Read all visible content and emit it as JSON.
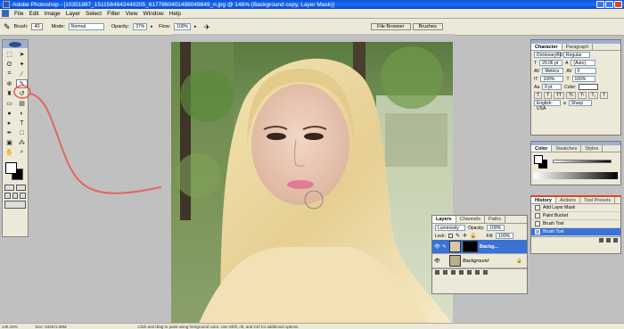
{
  "window": {
    "title": "Adobe Photoshop - [10351887_1511564642440205_6177860401498049649_n.jpg @ 146% (Background copy, Layer Mask)]"
  },
  "menu": [
    "File",
    "Edit",
    "Image",
    "Layer",
    "Select",
    "Filter",
    "View",
    "Window",
    "Help"
  ],
  "options_bar": {
    "brush_label": "Brush:",
    "brush_size": "40",
    "mode_label": "Mode:",
    "mode_value": "Normal",
    "opacity_label": "Opacity:",
    "opacity_value": "37%",
    "flow_label": "Flow:",
    "flow_value": "100%"
  },
  "palette_well": {
    "tabs": [
      "File Browser",
      "Brushes"
    ]
  },
  "character_panel": {
    "tabs": [
      "Character",
      "Paragraph"
    ],
    "font_family": "DictionaryBD",
    "font_style": "Regular",
    "font_size": "29.06 pt",
    "leading": "(Auto)",
    "kerning": "Metrics",
    "tracking": "0",
    "vertical_scale": "100%",
    "horizontal_scale": "100%",
    "baseline_shift": "0 pt",
    "color_label": "Color:",
    "language": "English: USA",
    "antialias_label": "a",
    "antialias_value": "Sharp"
  },
  "color_panel": {
    "tabs": [
      "Color",
      "Swatches",
      "Styles"
    ]
  },
  "layers_panel": {
    "tabs": [
      "Layers",
      "Channels",
      "Paths"
    ],
    "blend_mode": "Luminosity",
    "opacity_label": "Opacity:",
    "opacity_value": "100%",
    "lock_label": "Lock:",
    "fill_label": "Fill:",
    "fill_value": "100%",
    "layers": [
      {
        "name": "Backg...",
        "selected": true,
        "has_mask": true
      },
      {
        "name": "Background",
        "selected": false,
        "has_mask": false
      }
    ]
  },
  "history_panel": {
    "tabs": [
      "History",
      "Actions",
      "Tool Presets"
    ],
    "items": [
      "Add Layer Mask",
      "Paint Bucket",
      "Brush Tool",
      "Brush Tool"
    ],
    "selected_index": 3
  },
  "status_bar": {
    "zoom": "146.15%",
    "doc": "Doc: 542K/1.08M",
    "hint": "Click and drag to paint using foreground color. Use Shift, Alt, and Ctrl for additional options."
  },
  "colors": {
    "annotation_red": "#e8574e",
    "highlight": "#3a72d6"
  }
}
